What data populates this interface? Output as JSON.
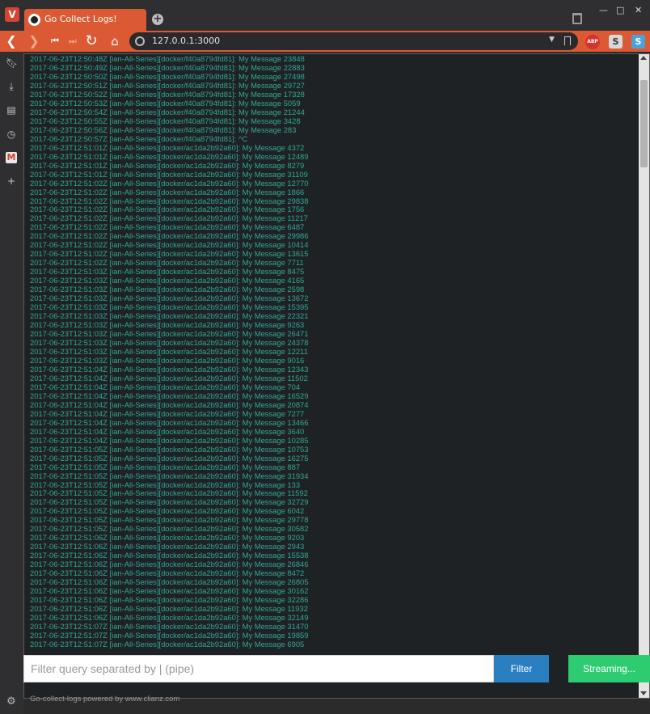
{
  "browser": {
    "tab_title": "Go Collect Logs!",
    "url": "127.0.0.1:3000",
    "icons": [
      "vivaldi-icon",
      "new-tab-icon",
      "trash-icon",
      "back-icon",
      "forward-icon",
      "rewind-icon",
      "fast-forward-icon",
      "reload-icon",
      "home-icon",
      "globe-icon",
      "dropdown-icon",
      "bookmark-icon",
      "adblock-icon",
      "extension-s-icon",
      "extension-s2-icon"
    ],
    "abp_label": "ABP",
    "ext1_label": "S",
    "ext2_label": "S"
  },
  "sidebar": {
    "items": [
      "bookmarks-icon",
      "downloads-icon",
      "notes-icon",
      "history-icon",
      "gmail-icon",
      "add-panel-icon"
    ],
    "gmail_label": "M",
    "add_label": "+"
  },
  "logs": {
    "lines": [
      "2017-06-23T12:50:48Z [ian-All-Series][docker/f40a8794fd81]: My Message 23848",
      "2017-06-23T12:50:49Z [ian-All-Series][docker/f40a8794fd81]: My Message 22883",
      "2017-06-23T12:50:50Z [ian-All-Series][docker/f40a8794fd81]: My Message 27498",
      "2017-06-23T12:50:51Z [ian-All-Series][docker/f40a8794fd81]: My Message 29727",
      "2017-06-23T12:50:52Z [ian-All-Series][docker/f40a8794fd81]: My Message 17328",
      "2017-06-23T12:50:53Z [ian-All-Series][docker/f40a8794fd81]: My Message 5059",
      "2017-06-23T12:50:54Z [ian-All-Series][docker/f40a8794fd81]: My Message 21244",
      "2017-06-23T12:50:55Z [ian-All-Series][docker/f40a8794fd81]: My Message 3428",
      "2017-06-23T12:50:56Z [ian-All-Series][docker/f40a8794fd81]: My Message 283",
      "2017-06-23T12:50:57Z [ian-All-Series][docker/f40a8794fd81]: ^C",
      "2017-06-23T12:51:01Z [ian-All-Series][docker/ac1da2b92a60]: My Message 4372",
      "2017-06-23T12:51:01Z [ian-All-Series][docker/ac1da2b92a60]: My Message 12489",
      "2017-06-23T12:51:01Z [ian-All-Series][docker/ac1da2b92a60]: My Message 8279",
      "2017-06-23T12:51:01Z [ian-All-Series][docker/ac1da2b92a60]: My Message 31109",
      "2017-06-23T12:51:02Z [ian-All-Series][docker/ac1da2b92a60]: My Message 12770",
      "2017-06-23T12:51:02Z [ian-All-Series][docker/ac1da2b92a60]: My Message 1866",
      "2017-06-23T12:51:02Z [ian-All-Series][docker/ac1da2b92a60]: My Message 29838",
      "2017-06-23T12:51:02Z [ian-All-Series][docker/ac1da2b92a60]: My Message 1756",
      "2017-06-23T12:51:02Z [ian-All-Series][docker/ac1da2b92a60]: My Message 11217",
      "2017-06-23T12:51:02Z [ian-All-Series][docker/ac1da2b92a60]: My Message 6487",
      "2017-06-23T12:51:02Z [ian-All-Series][docker/ac1da2b92a60]: My Message 29986",
      "2017-06-23T12:51:02Z [ian-All-Series][docker/ac1da2b92a60]: My Message 10414",
      "2017-06-23T12:51:02Z [ian-All-Series][docker/ac1da2b92a60]: My Message 13615",
      "2017-06-23T12:51:02Z [ian-All-Series][docker/ac1da2b92a60]: My Message 7711",
      "2017-06-23T12:51:03Z [ian-All-Series][docker/ac1da2b92a60]: My Message 8475",
      "2017-06-23T12:51:03Z [ian-All-Series][docker/ac1da2b92a60]: My Message 4165",
      "2017-06-23T12:51:03Z [ian-All-Series][docker/ac1da2b92a60]: My Message 2598",
      "2017-06-23T12:51:03Z [ian-All-Series][docker/ac1da2b92a60]: My Message 13672",
      "2017-06-23T12:51:03Z [ian-All-Series][docker/ac1da2b92a60]: My Message 15395",
      "2017-06-23T12:51:03Z [ian-All-Series][docker/ac1da2b92a60]: My Message 22321",
      "2017-06-23T12:51:03Z [ian-All-Series][docker/ac1da2b92a60]: My Message 9263",
      "2017-06-23T12:51:03Z [ian-All-Series][docker/ac1da2b92a60]: My Message 26471",
      "2017-06-23T12:51:03Z [ian-All-Series][docker/ac1da2b92a60]: My Message 24378",
      "2017-06-23T12:51:03Z [ian-All-Series][docker/ac1da2b92a60]: My Message 12211",
      "2017-06-23T12:51:03Z [ian-All-Series][docker/ac1da2b92a60]: My Message 9016",
      "2017-06-23T12:51:04Z [ian-All-Series][docker/ac1da2b92a60]: My Message 12343",
      "2017-06-23T12:51:04Z [ian-All-Series][docker/ac1da2b92a60]: My Message 11502",
      "2017-06-23T12:51:04Z [ian-All-Series][docker/ac1da2b92a60]: My Message 704",
      "2017-06-23T12:51:04Z [ian-All-Series][docker/ac1da2b92a60]: My Message 16529",
      "2017-06-23T12:51:04Z [ian-All-Series][docker/ac1da2b92a60]: My Message 20874",
      "2017-06-23T12:51:04Z [ian-All-Series][docker/ac1da2b92a60]: My Message 7277",
      "2017-06-23T12:51:04Z [ian-All-Series][docker/ac1da2b92a60]: My Message 13466",
      "2017-06-23T12:51:04Z [ian-All-Series][docker/ac1da2b92a60]: My Message 3640",
      "2017-06-23T12:51:04Z [ian-All-Series][docker/ac1da2b92a60]: My Message 10285",
      "2017-06-23T12:51:05Z [ian-All-Series][docker/ac1da2b92a60]: My Message 10753",
      "2017-06-23T12:51:05Z [ian-All-Series][docker/ac1da2b92a60]: My Message 16275",
      "2017-06-23T12:51:05Z [ian-All-Series][docker/ac1da2b92a60]: My Message 887",
      "2017-06-23T12:51:05Z [ian-All-Series][docker/ac1da2b92a60]: My Message 31934",
      "2017-06-23T12:51:05Z [ian-All-Series][docker/ac1da2b92a60]: My Message 133",
      "2017-06-23T12:51:05Z [ian-All-Series][docker/ac1da2b92a60]: My Message 11592",
      "2017-06-23T12:51:05Z [ian-All-Series][docker/ac1da2b92a60]: My Message 32729",
      "2017-06-23T12:51:05Z [ian-All-Series][docker/ac1da2b92a60]: My Message 6042",
      "2017-06-23T12:51:05Z [ian-All-Series][docker/ac1da2b92a60]: My Message 29778",
      "2017-06-23T12:51:05Z [ian-All-Series][docker/ac1da2b92a60]: My Message 30582",
      "2017-06-23T12:51:06Z [ian-All-Series][docker/ac1da2b92a60]: My Message 9203",
      "2017-06-23T12:51:06Z [ian-All-Series][docker/ac1da2b92a60]: My Message 2943",
      "2017-06-23T12:51:06Z [ian-All-Series][docker/ac1da2b92a60]: My Message 15538",
      "2017-06-23T12:51:06Z [ian-All-Series][docker/ac1da2b92a60]: My Message 26846",
      "2017-06-23T12:51:06Z [ian-All-Series][docker/ac1da2b92a60]: My Message 8472",
      "2017-06-23T12:51:06Z [ian-All-Series][docker/ac1da2b92a60]: My Message 26805",
      "2017-06-23T12:51:06Z [ian-All-Series][docker/ac1da2b92a60]: My Message 30162",
      "2017-06-23T12:51:06Z [ian-All-Series][docker/ac1da2b92a60]: My Message 32286",
      "2017-06-23T12:51:06Z [ian-All-Series][docker/ac1da2b92a60]: My Message 11932",
      "2017-06-23T12:51:06Z [ian-All-Series][docker/ac1da2b92a60]: My Message 32149",
      "2017-06-23T12:51:07Z [ian-All-Series][docker/ac1da2b92a60]: My Message 31470",
      "2017-06-23T12:51:07Z [ian-All-Series][docker/ac1da2b92a60]: My Message 19859",
      "2017-06-23T12:51:07Z [ian-All-Series][docker/ac1da2b92a60]: My Message 6905"
    ],
    "text_color": "#31a897",
    "background_color": "#1f2225"
  },
  "controls": {
    "filter_placeholder": "Filter query separated by | (pipe)",
    "filter_value": "",
    "filter_label": "Filter",
    "filter_color": "#2a7fc1",
    "streaming_label": "Streaming...",
    "streaming_color": "#2ecc71"
  },
  "footer": {
    "text": "Go-collect-logs powered by www.clianz.com"
  },
  "theme": {
    "accent": "#db5a33"
  }
}
